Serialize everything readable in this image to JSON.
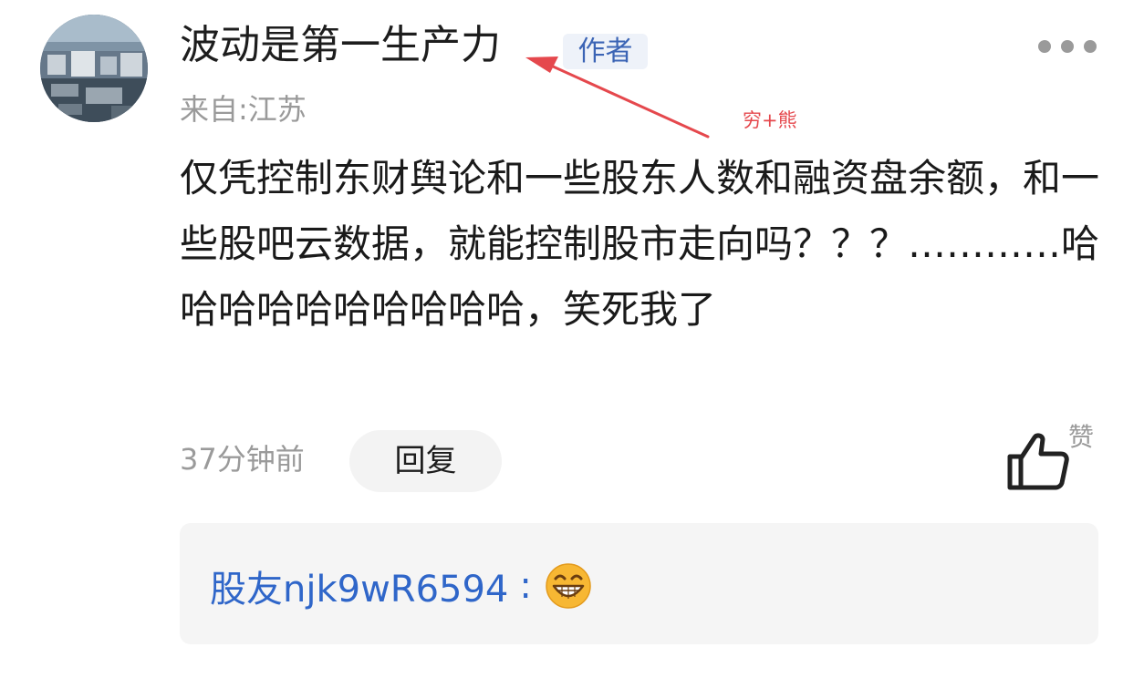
{
  "comment": {
    "username": "波动是第一生产力",
    "author_badge": "作者",
    "location": "来自:江苏",
    "body": "仅凭控制东财舆论和一些股东人数和融资盘余额，和一些股吧云数据，就能控制股市走向吗？？？…………哈哈哈哈哈哈哈哈哈哈，笑死我了",
    "timestamp": "37分钟前",
    "reply_label": "回复",
    "like_label": "赞"
  },
  "annotation": {
    "text": "穷+熊",
    "color": "#e5484d"
  },
  "reply": {
    "author": "股友njk9wR6594",
    "separator": ":",
    "emoji": "grinning-face-icon"
  },
  "colors": {
    "badge_bg": "#eef2f9",
    "badge_text": "#3b64b5",
    "reply_author": "#2f66c9",
    "secondary_text": "#9a9a9a"
  }
}
